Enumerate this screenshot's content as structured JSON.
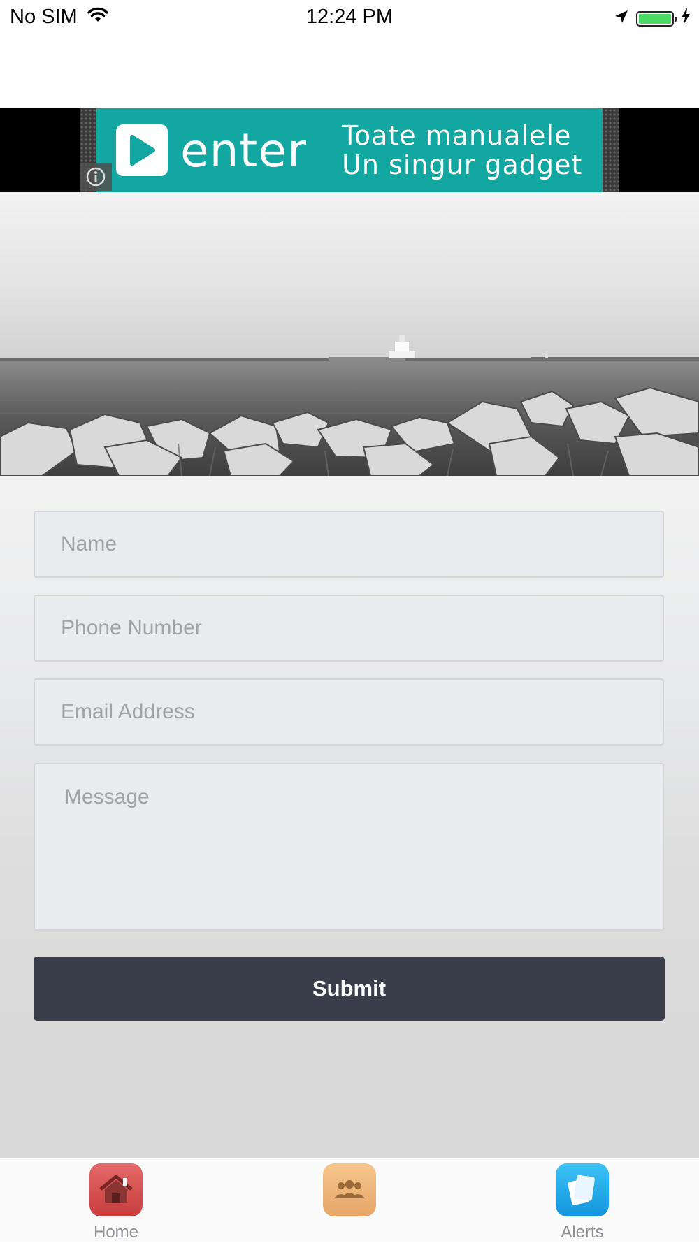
{
  "status_bar": {
    "carrier": "No SIM",
    "time": "12:24 PM"
  },
  "ad": {
    "brand": "enter",
    "tagline_line1": "Toate manualele",
    "tagline_line2": "Un singur gadget",
    "bg_color": "#12a7a0"
  },
  "form": {
    "name_placeholder": "Name",
    "phone_placeholder": "Phone Number",
    "email_placeholder": "Email Address",
    "message_placeholder": "Message",
    "submit_label": "Submit",
    "submit_color": "#393e4a"
  },
  "tab_bar": {
    "items": [
      {
        "label": "Home",
        "icon": "home-icon"
      },
      {
        "label": "",
        "icon": "members-icon"
      },
      {
        "label": "Alerts",
        "icon": "alerts-icon"
      }
    ]
  }
}
